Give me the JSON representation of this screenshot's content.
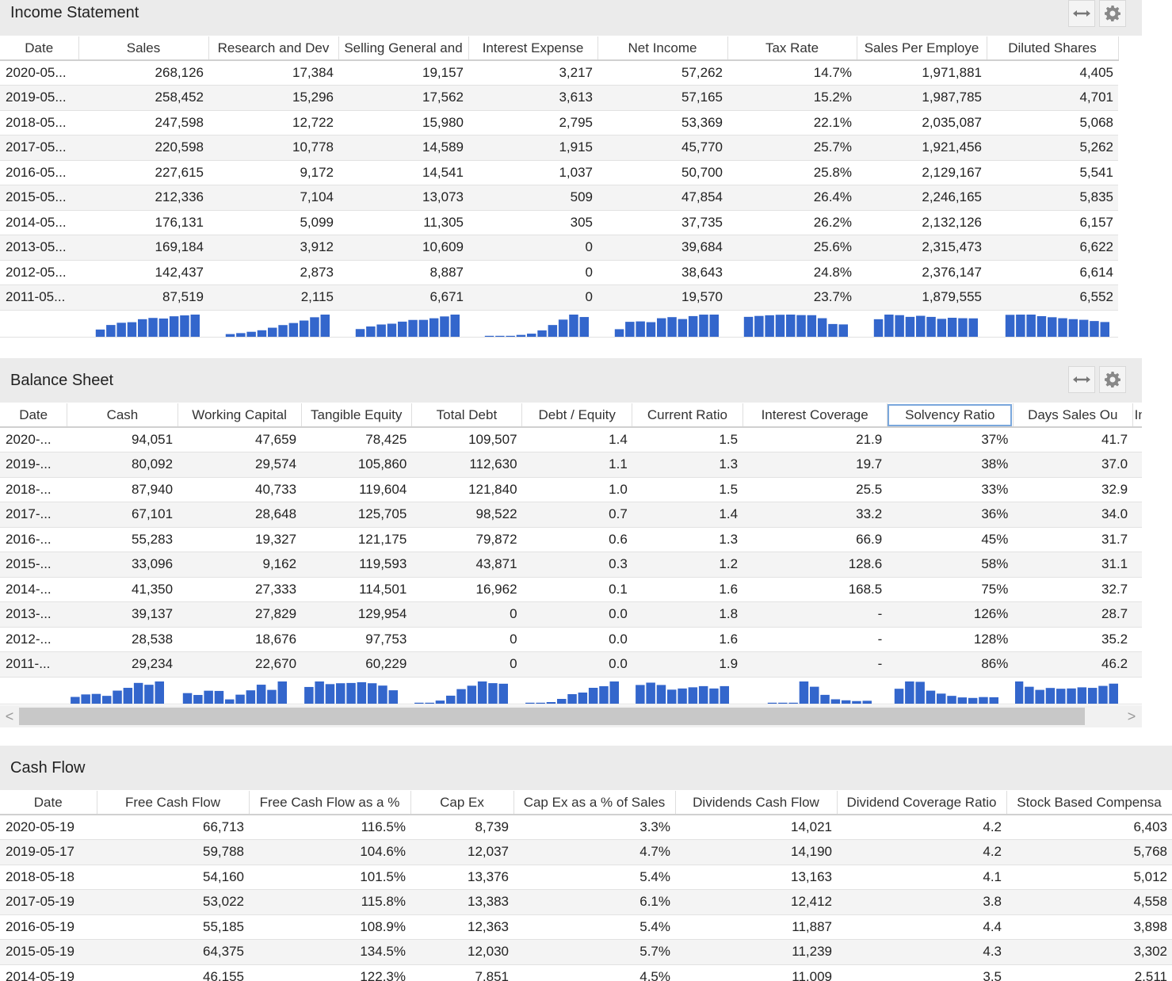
{
  "colors": {
    "bar": "#3366cc",
    "header_bg": "#ebebeb",
    "row_alt": "#f4f4f4"
  },
  "income": {
    "title": "Income Statement",
    "expand_icon": "double-arrow-icon",
    "settings_icon": "gear-icon",
    "columns": [
      "Date",
      "Sales",
      "Research and Dev",
      "Selling General and",
      "Interest Expense",
      "Net Income",
      "Tax Rate",
      "Sales Per Employe",
      "Diluted Shares"
    ],
    "rows": [
      [
        "2020-05...",
        "268,126",
        "17,384",
        "19,157",
        "3,217",
        "57,262",
        "14.7%",
        "1,971,881",
        "4,405"
      ],
      [
        "2019-05...",
        "258,452",
        "15,296",
        "17,562",
        "3,613",
        "57,165",
        "15.2%",
        "1,987,785",
        "4,701"
      ],
      [
        "2018-05...",
        "247,598",
        "12,722",
        "15,980",
        "2,795",
        "53,369",
        "22.1%",
        "2,035,087",
        "5,068"
      ],
      [
        "2017-05...",
        "220,598",
        "10,778",
        "14,589",
        "1,915",
        "45,770",
        "25.7%",
        "1,921,456",
        "5,262"
      ],
      [
        "2016-05...",
        "227,615",
        "9,172",
        "14,541",
        "1,037",
        "50,700",
        "25.8%",
        "2,129,167",
        "5,541"
      ],
      [
        "2015-05...",
        "212,336",
        "7,104",
        "13,073",
        "509",
        "47,854",
        "26.4%",
        "2,246,165",
        "5,835"
      ],
      [
        "2014-05...",
        "176,131",
        "5,099",
        "11,305",
        "305",
        "37,735",
        "26.2%",
        "2,132,126",
        "6,157"
      ],
      [
        "2013-05...",
        "169,184",
        "3,912",
        "10,609",
        "0",
        "39,684",
        "25.6%",
        "2,315,473",
        "6,622"
      ],
      [
        "2012-05...",
        "142,437",
        "2,873",
        "8,887",
        "0",
        "38,643",
        "24.8%",
        "2,376,147",
        "6,614"
      ],
      [
        "2011-05...",
        "87,519",
        "2,115",
        "6,671",
        "0",
        "19,570",
        "23.7%",
        "1,879,555",
        "6,552"
      ]
    ]
  },
  "balance": {
    "title": "Balance Sheet",
    "expand_icon": "double-arrow-icon",
    "settings_icon": "gear-icon",
    "selected_column": "Solvency Ratio",
    "columns": [
      "Date",
      "Cash",
      "Working Capital",
      "Tangible Equity",
      "Total Debt",
      "Debt / Equity",
      "Current Ratio",
      "Interest Coverage",
      "Solvency Ratio",
      "Days Sales Ou",
      "Inventor"
    ],
    "rows": [
      [
        "2020-...",
        "94,051",
        "47,659",
        "78,425",
        "109,507",
        "1.4",
        "1.5",
        "21.9",
        "37%",
        "41.7",
        ""
      ],
      [
        "2019-...",
        "80,092",
        "29,574",
        "105,860",
        "112,630",
        "1.1",
        "1.3",
        "19.7",
        "38%",
        "37.0",
        ""
      ],
      [
        "2018-...",
        "87,940",
        "40,733",
        "119,604",
        "121,840",
        "1.0",
        "1.5",
        "25.5",
        "33%",
        "32.9",
        ""
      ],
      [
        "2017-...",
        "67,101",
        "28,648",
        "125,705",
        "98,522",
        "0.7",
        "1.4",
        "33.2",
        "36%",
        "34.0",
        ""
      ],
      [
        "2016-...",
        "55,283",
        "19,327",
        "121,175",
        "79,872",
        "0.6",
        "1.3",
        "66.9",
        "45%",
        "31.7",
        ""
      ],
      [
        "2015-...",
        "33,096",
        "9,162",
        "119,593",
        "43,871",
        "0.3",
        "1.2",
        "128.6",
        "58%",
        "31.1",
        ""
      ],
      [
        "2014-...",
        "41,350",
        "27,333",
        "114,501",
        "16,962",
        "0.1",
        "1.6",
        "168.5",
        "75%",
        "32.7",
        ""
      ],
      [
        "2013-...",
        "39,137",
        "27,829",
        "129,954",
        "0",
        "0.0",
        "1.8",
        "-",
        "126%",
        "28.7",
        ""
      ],
      [
        "2012-...",
        "28,538",
        "18,676",
        "97,753",
        "0",
        "0.0",
        "1.6",
        "-",
        "128%",
        "35.2",
        ""
      ],
      [
        "2011-...",
        "29,234",
        "22,670",
        "60,229",
        "0",
        "0.0",
        "1.9",
        "-",
        "86%",
        "46.2",
        ""
      ]
    ],
    "scroll_left": "<",
    "scroll_right": ">"
  },
  "cashflow": {
    "title": "Cash Flow",
    "columns": [
      "Date",
      "Free Cash Flow",
      "Free Cash Flow as a %",
      "Cap Ex",
      "Cap Ex as a % of Sales",
      "Dividends Cash Flow",
      "Dividend Coverage Ratio",
      "Stock Based Compensa"
    ],
    "rows": [
      [
        "2020-05-19",
        "66,713",
        "116.5%",
        "8,739",
        "3.3%",
        "14,021",
        "4.2",
        "6,403"
      ],
      [
        "2019-05-17",
        "59,788",
        "104.6%",
        "12,037",
        "4.7%",
        "14,190",
        "4.2",
        "5,768"
      ],
      [
        "2018-05-18",
        "54,160",
        "101.5%",
        "13,376",
        "5.4%",
        "13,163",
        "4.1",
        "5,012"
      ],
      [
        "2017-05-19",
        "53,022",
        "115.8%",
        "13,383",
        "6.1%",
        "12,412",
        "3.8",
        "4,558"
      ],
      [
        "2016-05-19",
        "55,185",
        "108.9%",
        "12,363",
        "5.4%",
        "11,887",
        "4.4",
        "3,898"
      ],
      [
        "2015-05-19",
        "64,375",
        "134.5%",
        "12,030",
        "5.7%",
        "11,239",
        "4.3",
        "3,302"
      ],
      [
        "2014-05-19",
        "46,155",
        "122.3%",
        "7,851",
        "4.5%",
        "11,009",
        "3.5",
        "2,511"
      ]
    ]
  }
}
